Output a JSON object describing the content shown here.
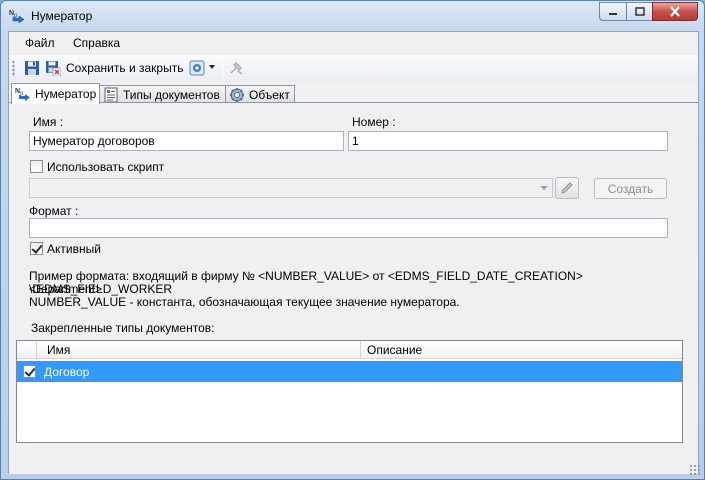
{
  "window": {
    "title": "Нумератор",
    "accent": "#3399ff"
  },
  "menu": {
    "items": [
      {
        "label": "Файл"
      },
      {
        "label": "Справка"
      }
    ]
  },
  "toolbar": {
    "save_label": "Сохранить и закрыть",
    "icons": [
      "save-icon",
      "save-close-icon",
      "settings-dropdown-icon",
      "disabled-tool-icon"
    ]
  },
  "tabs": [
    {
      "label": "Нумератор",
      "active": true,
      "icon": "numerator-icon"
    },
    {
      "label": "Типы документов",
      "active": false,
      "icon": "document-types-icon"
    },
    {
      "label": "Объект",
      "active": false,
      "icon": "gear-icon"
    }
  ],
  "form": {
    "name_label": "Имя :",
    "name_value": "Нумератор договоров",
    "number_label": "Номер :",
    "number_value": "1",
    "use_script_label": "Использовать скрипт",
    "use_script_checked": false,
    "script_value": "",
    "create_button": "Создать",
    "format_label": "Формат :",
    "format_value": "",
    "active_label": "Активный",
    "active_checked": true,
    "hint_line1": "Пример формата: входящий в фирму № <NUMBER_VALUE> от <EDMS_FIELD_DATE_CREATION> <EDMS_FIELD_WORKER",
    "hint_line2": "\\Department>",
    "hint_line3": "NUMBER_VALUE - константа, обозначающая текущее значение нумератора.",
    "doc_types_label": "Закрепленные типы документов:"
  },
  "grid": {
    "columns": [
      "Имя",
      "Описание"
    ],
    "rows": [
      {
        "checked": true,
        "name": "Договор",
        "description": ""
      }
    ]
  }
}
